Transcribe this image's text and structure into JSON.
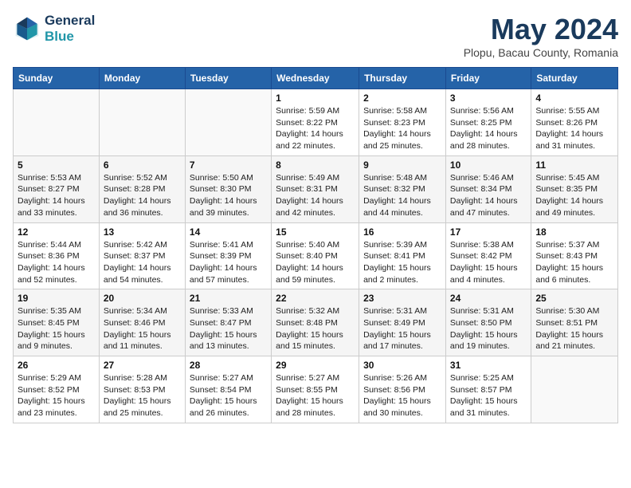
{
  "header": {
    "logo_line1": "General",
    "logo_line2": "Blue",
    "month_title": "May 2024",
    "location": "Plopu, Bacau County, Romania"
  },
  "days_of_week": [
    "Sunday",
    "Monday",
    "Tuesday",
    "Wednesday",
    "Thursday",
    "Friday",
    "Saturday"
  ],
  "weeks": [
    [
      {
        "day": "",
        "info": ""
      },
      {
        "day": "",
        "info": ""
      },
      {
        "day": "",
        "info": ""
      },
      {
        "day": "1",
        "info": "Sunrise: 5:59 AM\nSunset: 8:22 PM\nDaylight: 14 hours\nand 22 minutes."
      },
      {
        "day": "2",
        "info": "Sunrise: 5:58 AM\nSunset: 8:23 PM\nDaylight: 14 hours\nand 25 minutes."
      },
      {
        "day": "3",
        "info": "Sunrise: 5:56 AM\nSunset: 8:25 PM\nDaylight: 14 hours\nand 28 minutes."
      },
      {
        "day": "4",
        "info": "Sunrise: 5:55 AM\nSunset: 8:26 PM\nDaylight: 14 hours\nand 31 minutes."
      }
    ],
    [
      {
        "day": "5",
        "info": "Sunrise: 5:53 AM\nSunset: 8:27 PM\nDaylight: 14 hours\nand 33 minutes."
      },
      {
        "day": "6",
        "info": "Sunrise: 5:52 AM\nSunset: 8:28 PM\nDaylight: 14 hours\nand 36 minutes."
      },
      {
        "day": "7",
        "info": "Sunrise: 5:50 AM\nSunset: 8:30 PM\nDaylight: 14 hours\nand 39 minutes."
      },
      {
        "day": "8",
        "info": "Sunrise: 5:49 AM\nSunset: 8:31 PM\nDaylight: 14 hours\nand 42 minutes."
      },
      {
        "day": "9",
        "info": "Sunrise: 5:48 AM\nSunset: 8:32 PM\nDaylight: 14 hours\nand 44 minutes."
      },
      {
        "day": "10",
        "info": "Sunrise: 5:46 AM\nSunset: 8:34 PM\nDaylight: 14 hours\nand 47 minutes."
      },
      {
        "day": "11",
        "info": "Sunrise: 5:45 AM\nSunset: 8:35 PM\nDaylight: 14 hours\nand 49 minutes."
      }
    ],
    [
      {
        "day": "12",
        "info": "Sunrise: 5:44 AM\nSunset: 8:36 PM\nDaylight: 14 hours\nand 52 minutes."
      },
      {
        "day": "13",
        "info": "Sunrise: 5:42 AM\nSunset: 8:37 PM\nDaylight: 14 hours\nand 54 minutes."
      },
      {
        "day": "14",
        "info": "Sunrise: 5:41 AM\nSunset: 8:39 PM\nDaylight: 14 hours\nand 57 minutes."
      },
      {
        "day": "15",
        "info": "Sunrise: 5:40 AM\nSunset: 8:40 PM\nDaylight: 14 hours\nand 59 minutes."
      },
      {
        "day": "16",
        "info": "Sunrise: 5:39 AM\nSunset: 8:41 PM\nDaylight: 15 hours\nand 2 minutes."
      },
      {
        "day": "17",
        "info": "Sunrise: 5:38 AM\nSunset: 8:42 PM\nDaylight: 15 hours\nand 4 minutes."
      },
      {
        "day": "18",
        "info": "Sunrise: 5:37 AM\nSunset: 8:43 PM\nDaylight: 15 hours\nand 6 minutes."
      }
    ],
    [
      {
        "day": "19",
        "info": "Sunrise: 5:35 AM\nSunset: 8:45 PM\nDaylight: 15 hours\nand 9 minutes."
      },
      {
        "day": "20",
        "info": "Sunrise: 5:34 AM\nSunset: 8:46 PM\nDaylight: 15 hours\nand 11 minutes."
      },
      {
        "day": "21",
        "info": "Sunrise: 5:33 AM\nSunset: 8:47 PM\nDaylight: 15 hours\nand 13 minutes."
      },
      {
        "day": "22",
        "info": "Sunrise: 5:32 AM\nSunset: 8:48 PM\nDaylight: 15 hours\nand 15 minutes."
      },
      {
        "day": "23",
        "info": "Sunrise: 5:31 AM\nSunset: 8:49 PM\nDaylight: 15 hours\nand 17 minutes."
      },
      {
        "day": "24",
        "info": "Sunrise: 5:31 AM\nSunset: 8:50 PM\nDaylight: 15 hours\nand 19 minutes."
      },
      {
        "day": "25",
        "info": "Sunrise: 5:30 AM\nSunset: 8:51 PM\nDaylight: 15 hours\nand 21 minutes."
      }
    ],
    [
      {
        "day": "26",
        "info": "Sunrise: 5:29 AM\nSunset: 8:52 PM\nDaylight: 15 hours\nand 23 minutes."
      },
      {
        "day": "27",
        "info": "Sunrise: 5:28 AM\nSunset: 8:53 PM\nDaylight: 15 hours\nand 25 minutes."
      },
      {
        "day": "28",
        "info": "Sunrise: 5:27 AM\nSunset: 8:54 PM\nDaylight: 15 hours\nand 26 minutes."
      },
      {
        "day": "29",
        "info": "Sunrise: 5:27 AM\nSunset: 8:55 PM\nDaylight: 15 hours\nand 28 minutes."
      },
      {
        "day": "30",
        "info": "Sunrise: 5:26 AM\nSunset: 8:56 PM\nDaylight: 15 hours\nand 30 minutes."
      },
      {
        "day": "31",
        "info": "Sunrise: 5:25 AM\nSunset: 8:57 PM\nDaylight: 15 hours\nand 31 minutes."
      },
      {
        "day": "",
        "info": ""
      }
    ]
  ]
}
